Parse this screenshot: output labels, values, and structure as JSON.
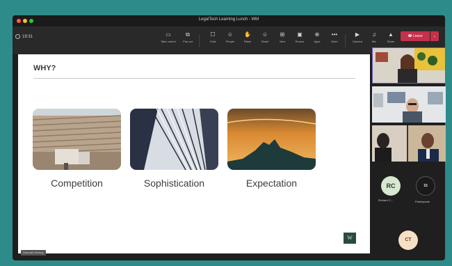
{
  "window": {
    "title": "LegalTech Learning Lunch - WM",
    "traffic_lights": [
      "#ff5f56",
      "#ffbd2e",
      "#27c93f"
    ]
  },
  "toolbar": {
    "timer": "19:31",
    "buttons": [
      {
        "icon": "take-control-icon",
        "glyph": "▭",
        "label": "Take control"
      },
      {
        "icon": "pop-out-icon",
        "glyph": "⧉",
        "label": "Pop out"
      },
      {
        "icon": "chat-icon",
        "glyph": "☐",
        "label": "Chat"
      },
      {
        "icon": "people-icon",
        "glyph": "☺",
        "label": "People"
      },
      {
        "icon": "raise-hand-icon",
        "glyph": "✋",
        "label": "Raise"
      },
      {
        "icon": "react-icon",
        "glyph": "☺",
        "label": "React"
      },
      {
        "icon": "view-icon",
        "glyph": "⊞",
        "label": "View"
      },
      {
        "icon": "rooms-icon",
        "glyph": "▣",
        "label": "Rooms"
      },
      {
        "icon": "apps-icon",
        "glyph": "⊕",
        "label": "Apps"
      },
      {
        "icon": "more-icon",
        "glyph": "•••",
        "label": "More"
      },
      {
        "icon": "camera-icon",
        "glyph": "▶",
        "label": "Camera"
      },
      {
        "icon": "mic-icon",
        "glyph": "♫",
        "label": "Mic"
      },
      {
        "icon": "share-icon",
        "glyph": "▲",
        "label": "Share"
      }
    ],
    "leave_label": "Leave",
    "leave_color": "#c4314b"
  },
  "slide": {
    "title": "WHY?",
    "cards": [
      {
        "caption": "Competition"
      },
      {
        "caption": "Sophistication"
      },
      {
        "caption": "Expectation"
      }
    ],
    "logo": "W"
  },
  "presenter_name": "Deborah Herring",
  "participants": [
    {
      "initials": "RC",
      "name": "Richard C..."
    },
    {
      "initials": "15",
      "name": "Participants"
    },
    {
      "initials": "CT"
    }
  ]
}
